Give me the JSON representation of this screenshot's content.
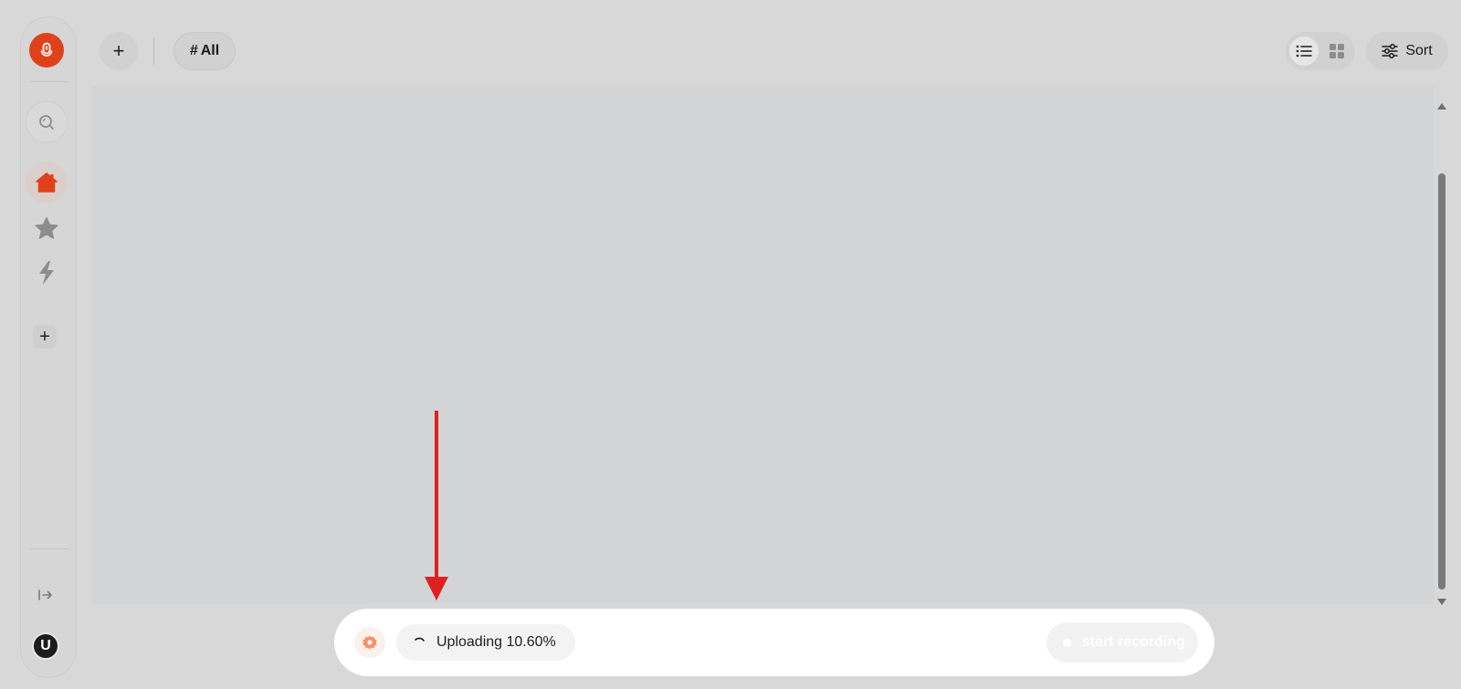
{
  "sidebar": {
    "logo_icon": "microphone-icon",
    "search_icon": "search-icon",
    "nav": [
      {
        "name": "home",
        "icon": "home-icon",
        "active": true
      },
      {
        "name": "starred",
        "icon": "star-icon",
        "active": false
      },
      {
        "name": "quick",
        "icon": "bolt-icon",
        "active": false
      }
    ],
    "add_label": "+",
    "collapse_icon": "collapse-arrow-icon",
    "avatar_initial": "U"
  },
  "toolbar": {
    "add_label": "+",
    "tag_hash": "#",
    "tag_label": "All",
    "view_modes": [
      "list",
      "grid"
    ],
    "active_view": "list",
    "sort_label": "Sort"
  },
  "upload": {
    "status_text": "Uploading 10.60%",
    "progress_percent": 10.6
  },
  "record": {
    "label": "start recording",
    "enabled": false
  },
  "colors": {
    "accent": "#e0411a",
    "annotation": "#e02020",
    "background": "#d8d8d8",
    "content_bg": "#d3d4d6",
    "bottom_bar_bg": "#ffffff"
  }
}
